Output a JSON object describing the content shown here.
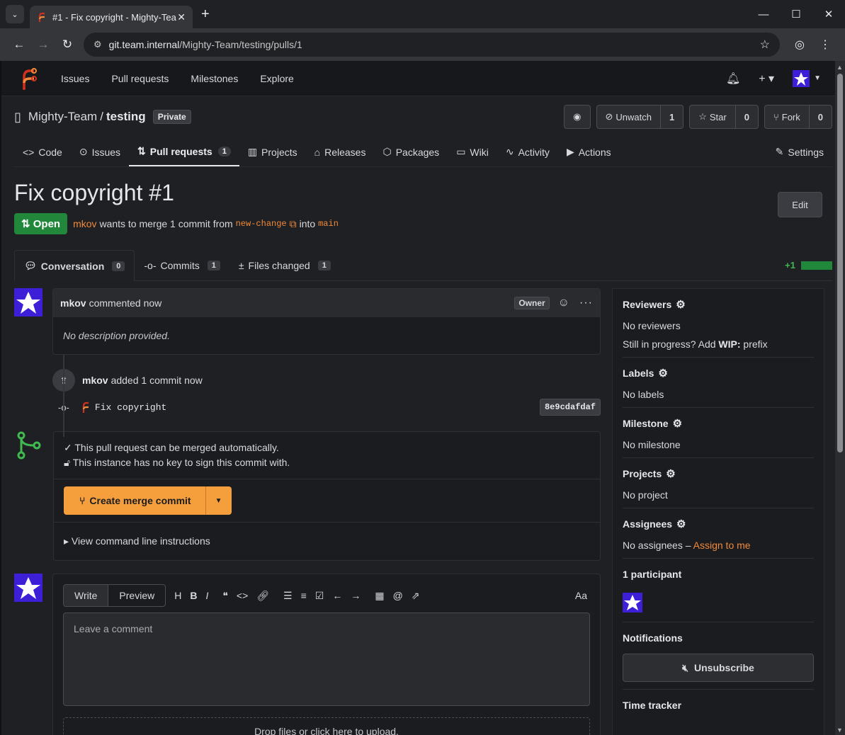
{
  "browser": {
    "tab_title": "#1 - Fix copyright - Mighty-Tea",
    "url_host": "git.team.internal",
    "url_path": "/Mighty-Team/testing/pulls/1"
  },
  "topnav": {
    "items": [
      "Issues",
      "Pull requests",
      "Milestones",
      "Explore"
    ]
  },
  "repo": {
    "owner": "Mighty-Team",
    "separator": "/",
    "name": "testing",
    "visibility": "Private",
    "unwatch_label": "Unwatch",
    "watch_count": "1",
    "star_label": "Star",
    "star_count": "0",
    "fork_label": "Fork",
    "fork_count": "0",
    "tabs": {
      "code": "Code",
      "issues": "Issues",
      "pulls": "Pull requests",
      "pulls_count": "1",
      "projects": "Projects",
      "releases": "Releases",
      "packages": "Packages",
      "wiki": "Wiki",
      "activity": "Activity",
      "actions": "Actions",
      "settings": "Settings"
    }
  },
  "pr": {
    "title": "Fix copyright #1",
    "edit_label": "Edit",
    "status": "Open",
    "author": "mkov",
    "meta_text": "wants to merge 1 commit from",
    "head_branch": "new-change",
    "into_text": "into",
    "base_branch": "main",
    "tabs": {
      "conversation": "Conversation",
      "conversation_count": "0",
      "commits": "Commits",
      "commits_count": "1",
      "files": "Files changed",
      "files_count": "1"
    },
    "diffstat_add": "+1"
  },
  "timeline": {
    "comment": {
      "author": "mkov",
      "action": "commented now",
      "role": "Owner",
      "body": "No description provided."
    },
    "event": {
      "author": "mkov",
      "action": "added 1 commit now"
    },
    "commit": {
      "message": "Fix copyright",
      "sha": "8e9cdafdaf"
    },
    "merge": {
      "check1": "This pull request can be merged automatically.",
      "check2": "This instance has no key to sign this commit with.",
      "button": "Create merge commit",
      "cli": "View command line instructions"
    },
    "editor": {
      "write": "Write",
      "preview": "Preview",
      "placeholder": "Leave a comment",
      "font_toggle": "Aa",
      "dropzone": "Drop files or click here to upload."
    }
  },
  "sidebar": {
    "reviewers_title": "Reviewers",
    "reviewers_value": "No reviewers",
    "wip_prefix_text": "Still in progress? Add",
    "wip_bold": "WIP:",
    "wip_suffix": "prefix",
    "labels_title": "Labels",
    "labels_value": "No labels",
    "milestone_title": "Milestone",
    "milestone_value": "No milestone",
    "projects_title": "Projects",
    "projects_value": "No project",
    "assignees_title": "Assignees",
    "assignees_value": "No assignees –",
    "assign_link": "Assign to me",
    "participants_title": "1 participant",
    "notifications_title": "Notifications",
    "unsubscribe": "Unsubscribe",
    "time_tracker_title": "Time tracker"
  },
  "colors": {
    "accent": "#f59f3c",
    "open_green": "#21883b",
    "avatar_purple": "#3d1fd8"
  }
}
